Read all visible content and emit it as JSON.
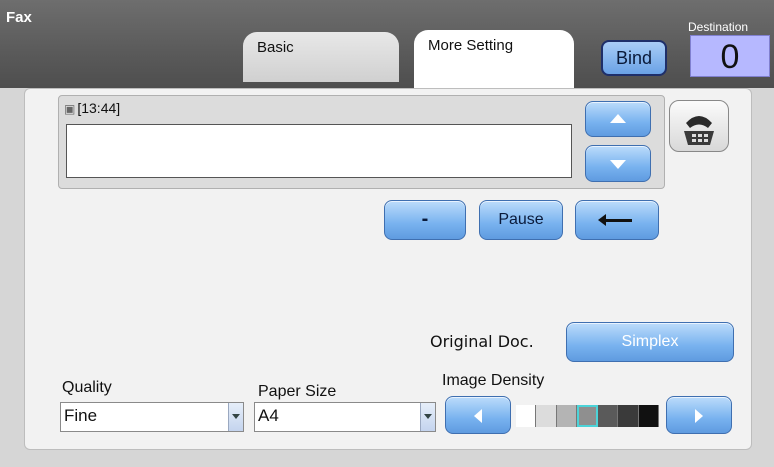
{
  "app": {
    "title": "Fax"
  },
  "tabs": [
    {
      "label": "Basic",
      "active": false
    },
    {
      "label": "More Setting",
      "active": true
    }
  ],
  "bind_button": {
    "label": "Bind"
  },
  "destination": {
    "label": "Destination",
    "count": "0"
  },
  "number_area": {
    "time": "[13:44]",
    "value": ""
  },
  "keys": {
    "dash": "-",
    "pause": "Pause",
    "backspace_icon": "left-arrow-icon"
  },
  "original_doc": {
    "label": "Original Doc.",
    "value": "Simplex"
  },
  "quality": {
    "label": "Quality",
    "value": "Fine"
  },
  "paper_size": {
    "label": "Paper Size",
    "value": "A4"
  },
  "image_density": {
    "label": "Image Density",
    "levels": 7,
    "selected_index": 3,
    "colors": [
      "#ffffff",
      "#dcdcdc",
      "#b4b4b4",
      "#8f8f8f",
      "#5a5a5a",
      "#3a3a3a",
      "#111111"
    ]
  },
  "colors": {
    "accent": "#78b2ef",
    "destination_bg": "#b6b8ff",
    "selection": "#4cd3d8"
  }
}
